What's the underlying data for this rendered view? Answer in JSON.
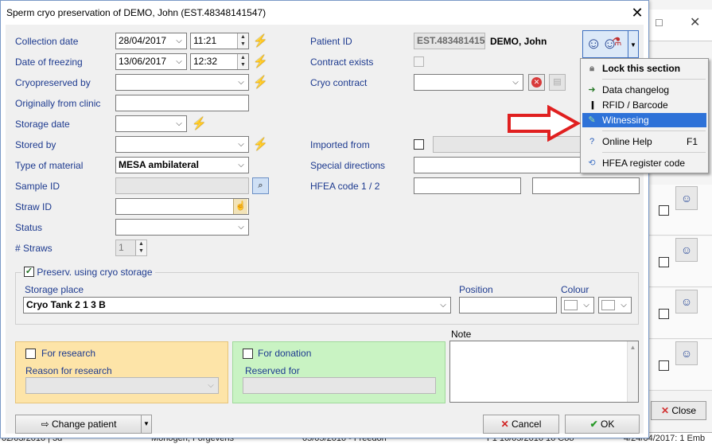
{
  "dialog": {
    "title": "Sperm cryo preservation of DEMO, John (EST.48348141547)",
    "close_glyph": "✕"
  },
  "form": {
    "collection_date_label": "Collection date",
    "collection_date": "28/04/2017",
    "collection_time": "11:21",
    "freezing_date_label": "Date of freezing",
    "freezing_date": "13/06/2017",
    "freezing_time": "12:32",
    "cryopreserved_by_label": "Cryopreserved by",
    "cryopreserved_by": "",
    "originally_from_clinic_label": "Originally from clinic",
    "originally_from_clinic": "",
    "storage_date_label": "Storage date",
    "storage_date": "",
    "stored_by_label": "Stored by",
    "stored_by": "",
    "type_of_material_label": "Type of material",
    "type_of_material": "MESA ambilateral",
    "sample_id_label": "Sample ID",
    "sample_id": "",
    "straw_id_label": "Straw ID",
    "straw_id": "",
    "status_label": "Status",
    "status": "",
    "straws_label": "# Straws",
    "straws_value": "1",
    "patient_id_label": "Patient ID",
    "patient_id": "EST.48348141547",
    "patient_name": "DEMO, John",
    "contract_exists_label": "Contract exists",
    "cryo_contract_label": "Cryo contract",
    "cryo_contract": "",
    "imported_from_label": "Imported from",
    "imported_from": "",
    "special_directions_label": "Special directions",
    "special_directions": "",
    "hfea_code_label": "HFEA code 1 / 2",
    "hfea_code_1": "",
    "hfea_code_2": ""
  },
  "storage": {
    "group_label": "Preserv. using cryo storage",
    "group_checked": true,
    "storage_place_label": "Storage place",
    "storage_place": "Cryo Tank 2 1 3 B",
    "position_label": "Position",
    "position": "",
    "colour_label": "Colour"
  },
  "research": {
    "label": "For research",
    "reason_label": "Reason for research",
    "reason": ""
  },
  "donation": {
    "label": "For donation",
    "reserved_label": "Reserved for",
    "reserved": ""
  },
  "note": {
    "label": "Note",
    "value": ""
  },
  "buttons": {
    "change_patient": "Change patient",
    "cancel": "Cancel",
    "ok": "OK"
  },
  "menu": {
    "items": [
      {
        "label": "Lock this section",
        "icon": "lock-icon",
        "bold": true
      },
      {
        "label": "Data changelog",
        "icon": "changelog-icon"
      },
      {
        "label": "RFID / Barcode",
        "icon": "barcode-icon"
      },
      {
        "label": "Witnessing",
        "icon": "witnessing-icon",
        "selected": true
      },
      {
        "label": "Online Help",
        "icon": "help-icon",
        "shortcut": "F1"
      },
      {
        "label": "HFEA register code",
        "icon": "register-icon"
      }
    ]
  },
  "background": {
    "close_button": "Close",
    "status_fragments": [
      "02/03/2016 | 3d",
      "Monogen, Forgevens",
      "05/05/2016 - Freedon",
      "F1 16/05/2016 16 Coo",
      "4/24/04/2017: 1 Emb"
    ]
  },
  "colors": {
    "label_blue": "#1d3a8f",
    "research_bg": "#fde4a8",
    "donation_bg": "#c9f3c3",
    "menu_highlight": "#2e72d8",
    "annotation_arrow": "#e02020",
    "bolt_yellow": "#e7c400"
  }
}
